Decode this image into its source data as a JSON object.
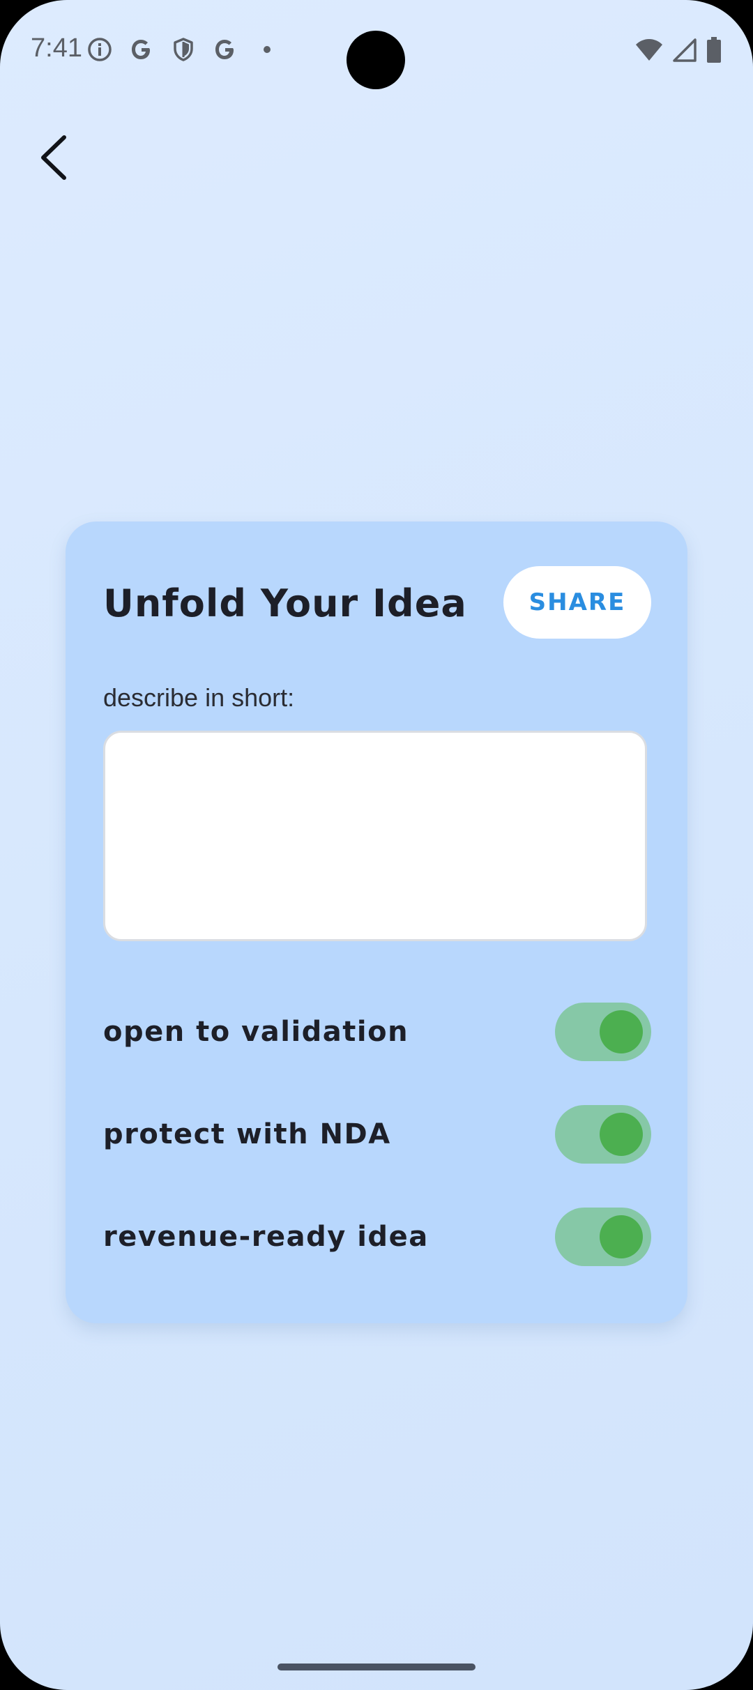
{
  "status_bar": {
    "time": "7:41",
    "left_icons": [
      "info-icon",
      "google-icon",
      "shield-icon",
      "google-icon",
      "dot-icon"
    ],
    "right_icons": [
      "wifi-icon",
      "signal-icon",
      "battery-icon"
    ]
  },
  "navigation": {
    "back_icon": "chevron-left-icon"
  },
  "card": {
    "title": "Unfold Your Idea",
    "share_label": "SHARE",
    "field_label": "describe in short:",
    "description_value": "",
    "toggles": [
      {
        "label": "open to validation",
        "on": true
      },
      {
        "label": "protect with NDA",
        "on": true
      },
      {
        "label": "revenue-ready idea",
        "on": true
      }
    ]
  },
  "colors": {
    "background": "#d8e8fd",
    "card": "#b8d7fd",
    "share_text": "#2a8de0",
    "toggle_track": "#86c8a7",
    "toggle_knob": "#4caf50",
    "title_text": "#1d1f28"
  }
}
